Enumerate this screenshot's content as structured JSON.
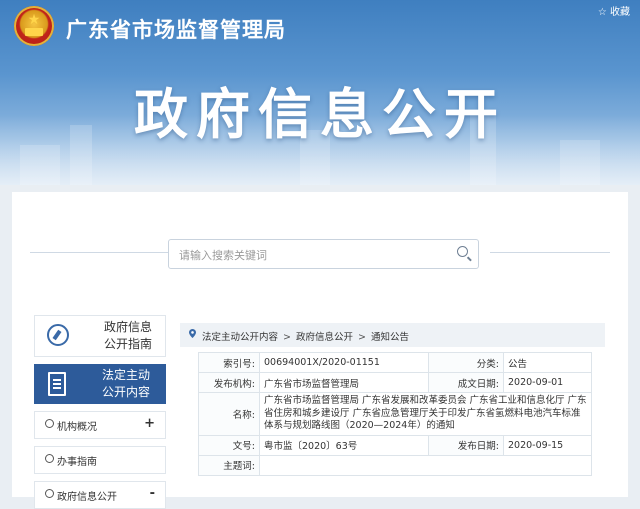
{
  "header": {
    "site_title": "广东省市场监督管理局",
    "favorite_label": "☆ 收藏",
    "big_title": "政府信息公开"
  },
  "search": {
    "placeholder": "请输入搜索关键词"
  },
  "sidebar": {
    "guide_label_1": "政府信息",
    "guide_label_2": "公开指南",
    "active_label_1": "法定主动",
    "active_label_2": "公开内容",
    "items": [
      {
        "label": "机构概况",
        "toggle": "+"
      },
      {
        "label": "办事指南",
        "toggle": ""
      },
      {
        "label": "政府信息公开",
        "toggle": "-"
      }
    ]
  },
  "breadcrumb": {
    "items": [
      "法定主动公开内容",
      "政府信息公开",
      "通知公告"
    ],
    "separator": ">"
  },
  "info_table": {
    "index_key": "索引号:",
    "index_value": "00694001X/2020-01151",
    "category_key": "分类:",
    "category_value": "公告",
    "publisher_key": "发布机构:",
    "publisher_value": "广东省市场监督管理局",
    "created_key": "成文日期:",
    "created_value": "2020-09-01",
    "name_key": "名称:",
    "name_value": "广东省市场监督管理局 广东省发展和改革委员会 广东省工业和信息化厅 广东省住房和城乡建设厅 广东省应急管理厅关于印发广东省氢燃料电池汽车标准体系与规划路线图（2020—2024年）的通知",
    "doc_no_key": "文号:",
    "doc_no_value": "粤市监〔2020〕63号",
    "publish_date_key": "发布日期:",
    "publish_date_value": "2020-09-15",
    "subject_key": "主题词:",
    "subject_value": ""
  }
}
